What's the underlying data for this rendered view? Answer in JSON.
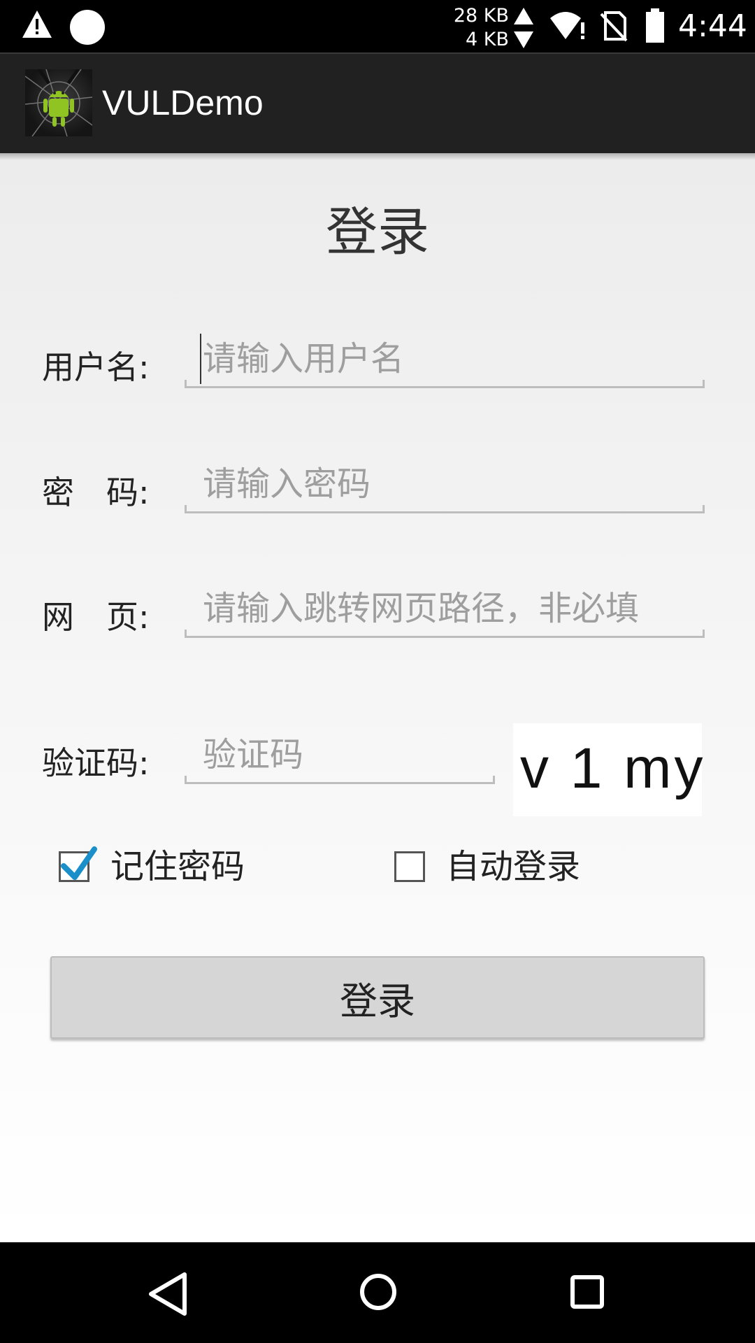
{
  "status_bar": {
    "upload_speed": "28 KB",
    "download_speed": "4 KB",
    "time": "4:44",
    "icons": [
      "warning-icon",
      "notification-circle-icon",
      "upload-arrow-icon",
      "download-arrow-icon",
      "wifi-icon",
      "no-sim-icon",
      "battery-icon"
    ]
  },
  "action_bar": {
    "app_icon": "android-bug-icon",
    "title": "VULDemo"
  },
  "form": {
    "title": "登录",
    "username": {
      "label": "用户名:",
      "placeholder": "请输入用户名",
      "value": ""
    },
    "password": {
      "label": "密　码:",
      "placeholder": "请输入密码",
      "value": ""
    },
    "webpage": {
      "label": "网　页:",
      "placeholder": "请输入跳转网页路径，非必填",
      "value": ""
    },
    "captcha": {
      "label": "验证码:",
      "placeholder": "验证码",
      "value": "",
      "image_text": "v 1 my"
    },
    "remember_password": {
      "label": "记住密码",
      "checked": true
    },
    "auto_login": {
      "label": "自动登录",
      "checked": false
    },
    "submit_label": "登录"
  },
  "nav_bar": {
    "icons": [
      "back-icon",
      "home-icon",
      "recent-apps-icon"
    ]
  },
  "colors": {
    "check_accent": "#1a8fc9",
    "action_bar_bg": "#212121",
    "button_bg": "#d6d6d6"
  }
}
